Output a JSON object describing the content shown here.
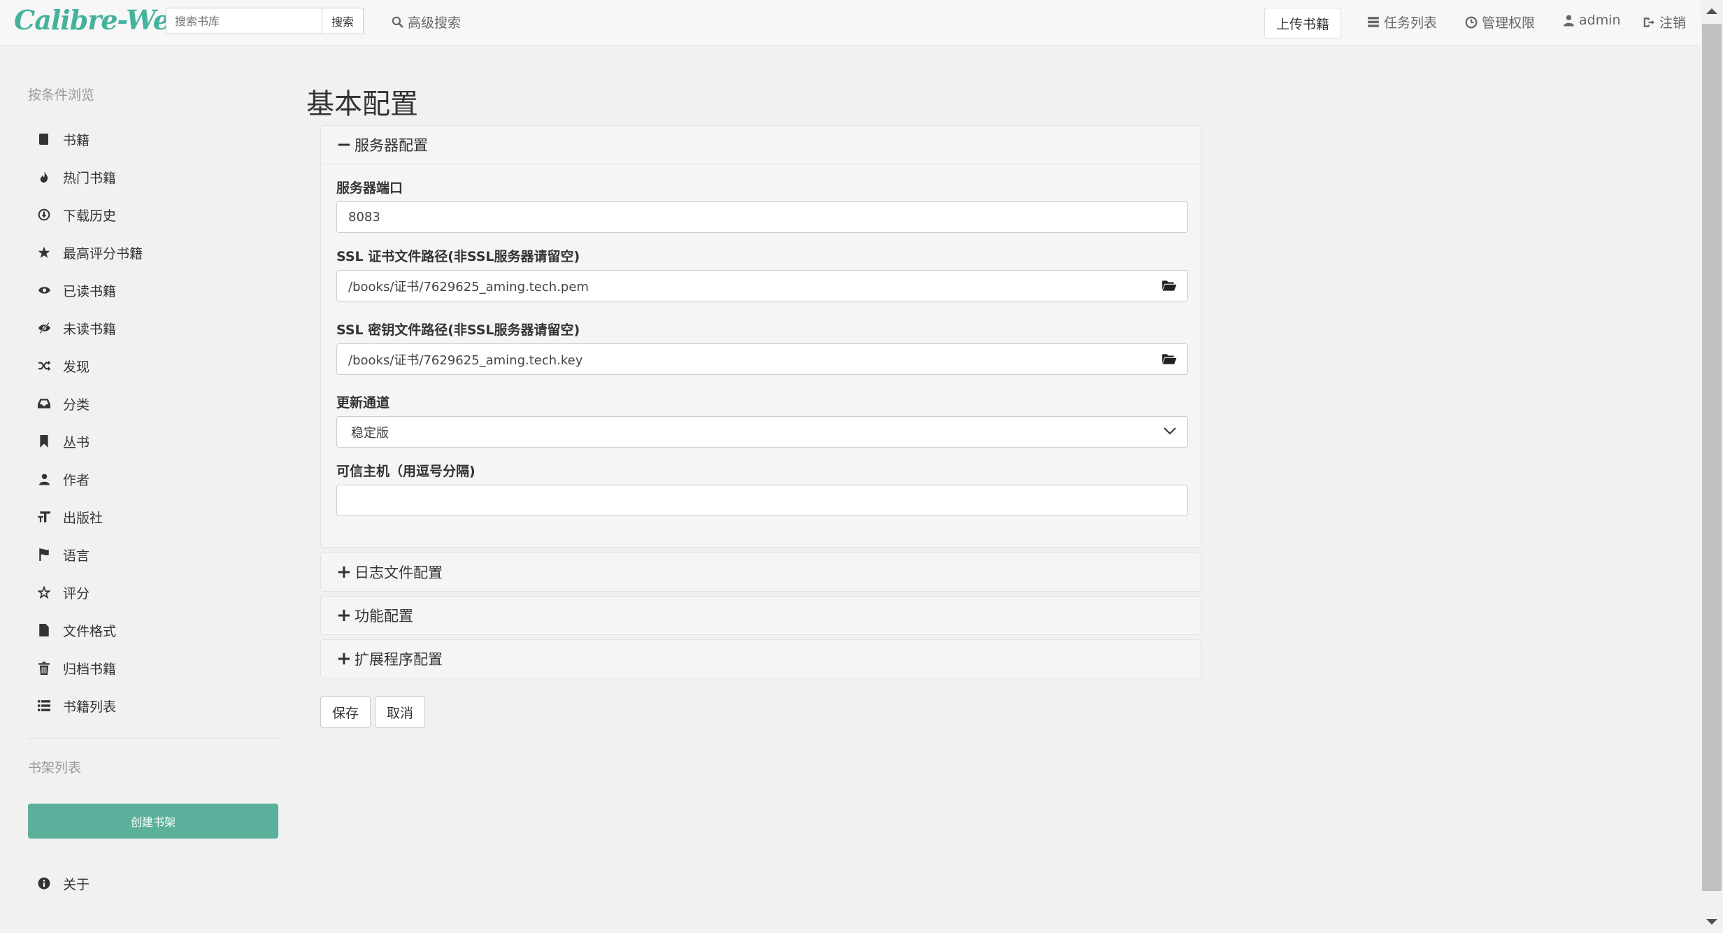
{
  "brand": "Calibre-Web",
  "search": {
    "placeholder": "搜索书库",
    "button_label": "搜索"
  },
  "advanced_search": "高级搜索",
  "nav": {
    "upload": "上传书籍",
    "tasks": "任务列表",
    "admin_panel": "管理权限",
    "user": "admin",
    "logout": "注销"
  },
  "sidebar": {
    "heading": "按条件浏览",
    "items": [
      {
        "label": "书籍",
        "icon": "book-icon"
      },
      {
        "label": "热门书籍",
        "icon": "fire-icon"
      },
      {
        "label": "下载历史",
        "icon": "download-icon"
      },
      {
        "label": "最高评分书籍",
        "icon": "star-icon"
      },
      {
        "label": "已读书籍",
        "icon": "eye-icon"
      },
      {
        "label": "未读书籍",
        "icon": "eye-slash-icon"
      },
      {
        "label": "发现",
        "icon": "random-icon"
      },
      {
        "label": "分类",
        "icon": "inbox-icon"
      },
      {
        "label": "丛书",
        "icon": "bookmark-icon"
      },
      {
        "label": "作者",
        "icon": "user-icon"
      },
      {
        "label": "出版社",
        "icon": "text-size-icon"
      },
      {
        "label": "语言",
        "icon": "flag-icon"
      },
      {
        "label": "评分",
        "icon": "star-empty-icon"
      },
      {
        "label": "文件格式",
        "icon": "file-icon"
      },
      {
        "label": "归档书籍",
        "icon": "trash-icon"
      },
      {
        "label": "书籍列表",
        "icon": "list-icon"
      }
    ],
    "shelves_heading": "书架列表",
    "create_shelf": "创建书架",
    "about": "关于"
  },
  "main": {
    "title": "基本配置",
    "server_panel": {
      "title": "服务器配置",
      "port_label": "服务器端口",
      "port_value": "8083",
      "cert_label": "SSL 证书文件路径(非SSL服务器请留空)",
      "cert_value": "/books/证书/7629625_aming.tech.pem",
      "key_label": "SSL 密钥文件路径(非SSL服务器请留空)",
      "key_value": "/books/证书/7629625_aming.tech.key",
      "channel_label": "更新通道",
      "channel_value": "稳定版",
      "hosts_label": "可信主机（用逗号分隔)",
      "hosts_value": ""
    },
    "log_panel": "日志文件配置",
    "feature_panel": "功能配置",
    "extension_panel": "扩展程序配置",
    "save": "保存",
    "cancel": "取消"
  }
}
